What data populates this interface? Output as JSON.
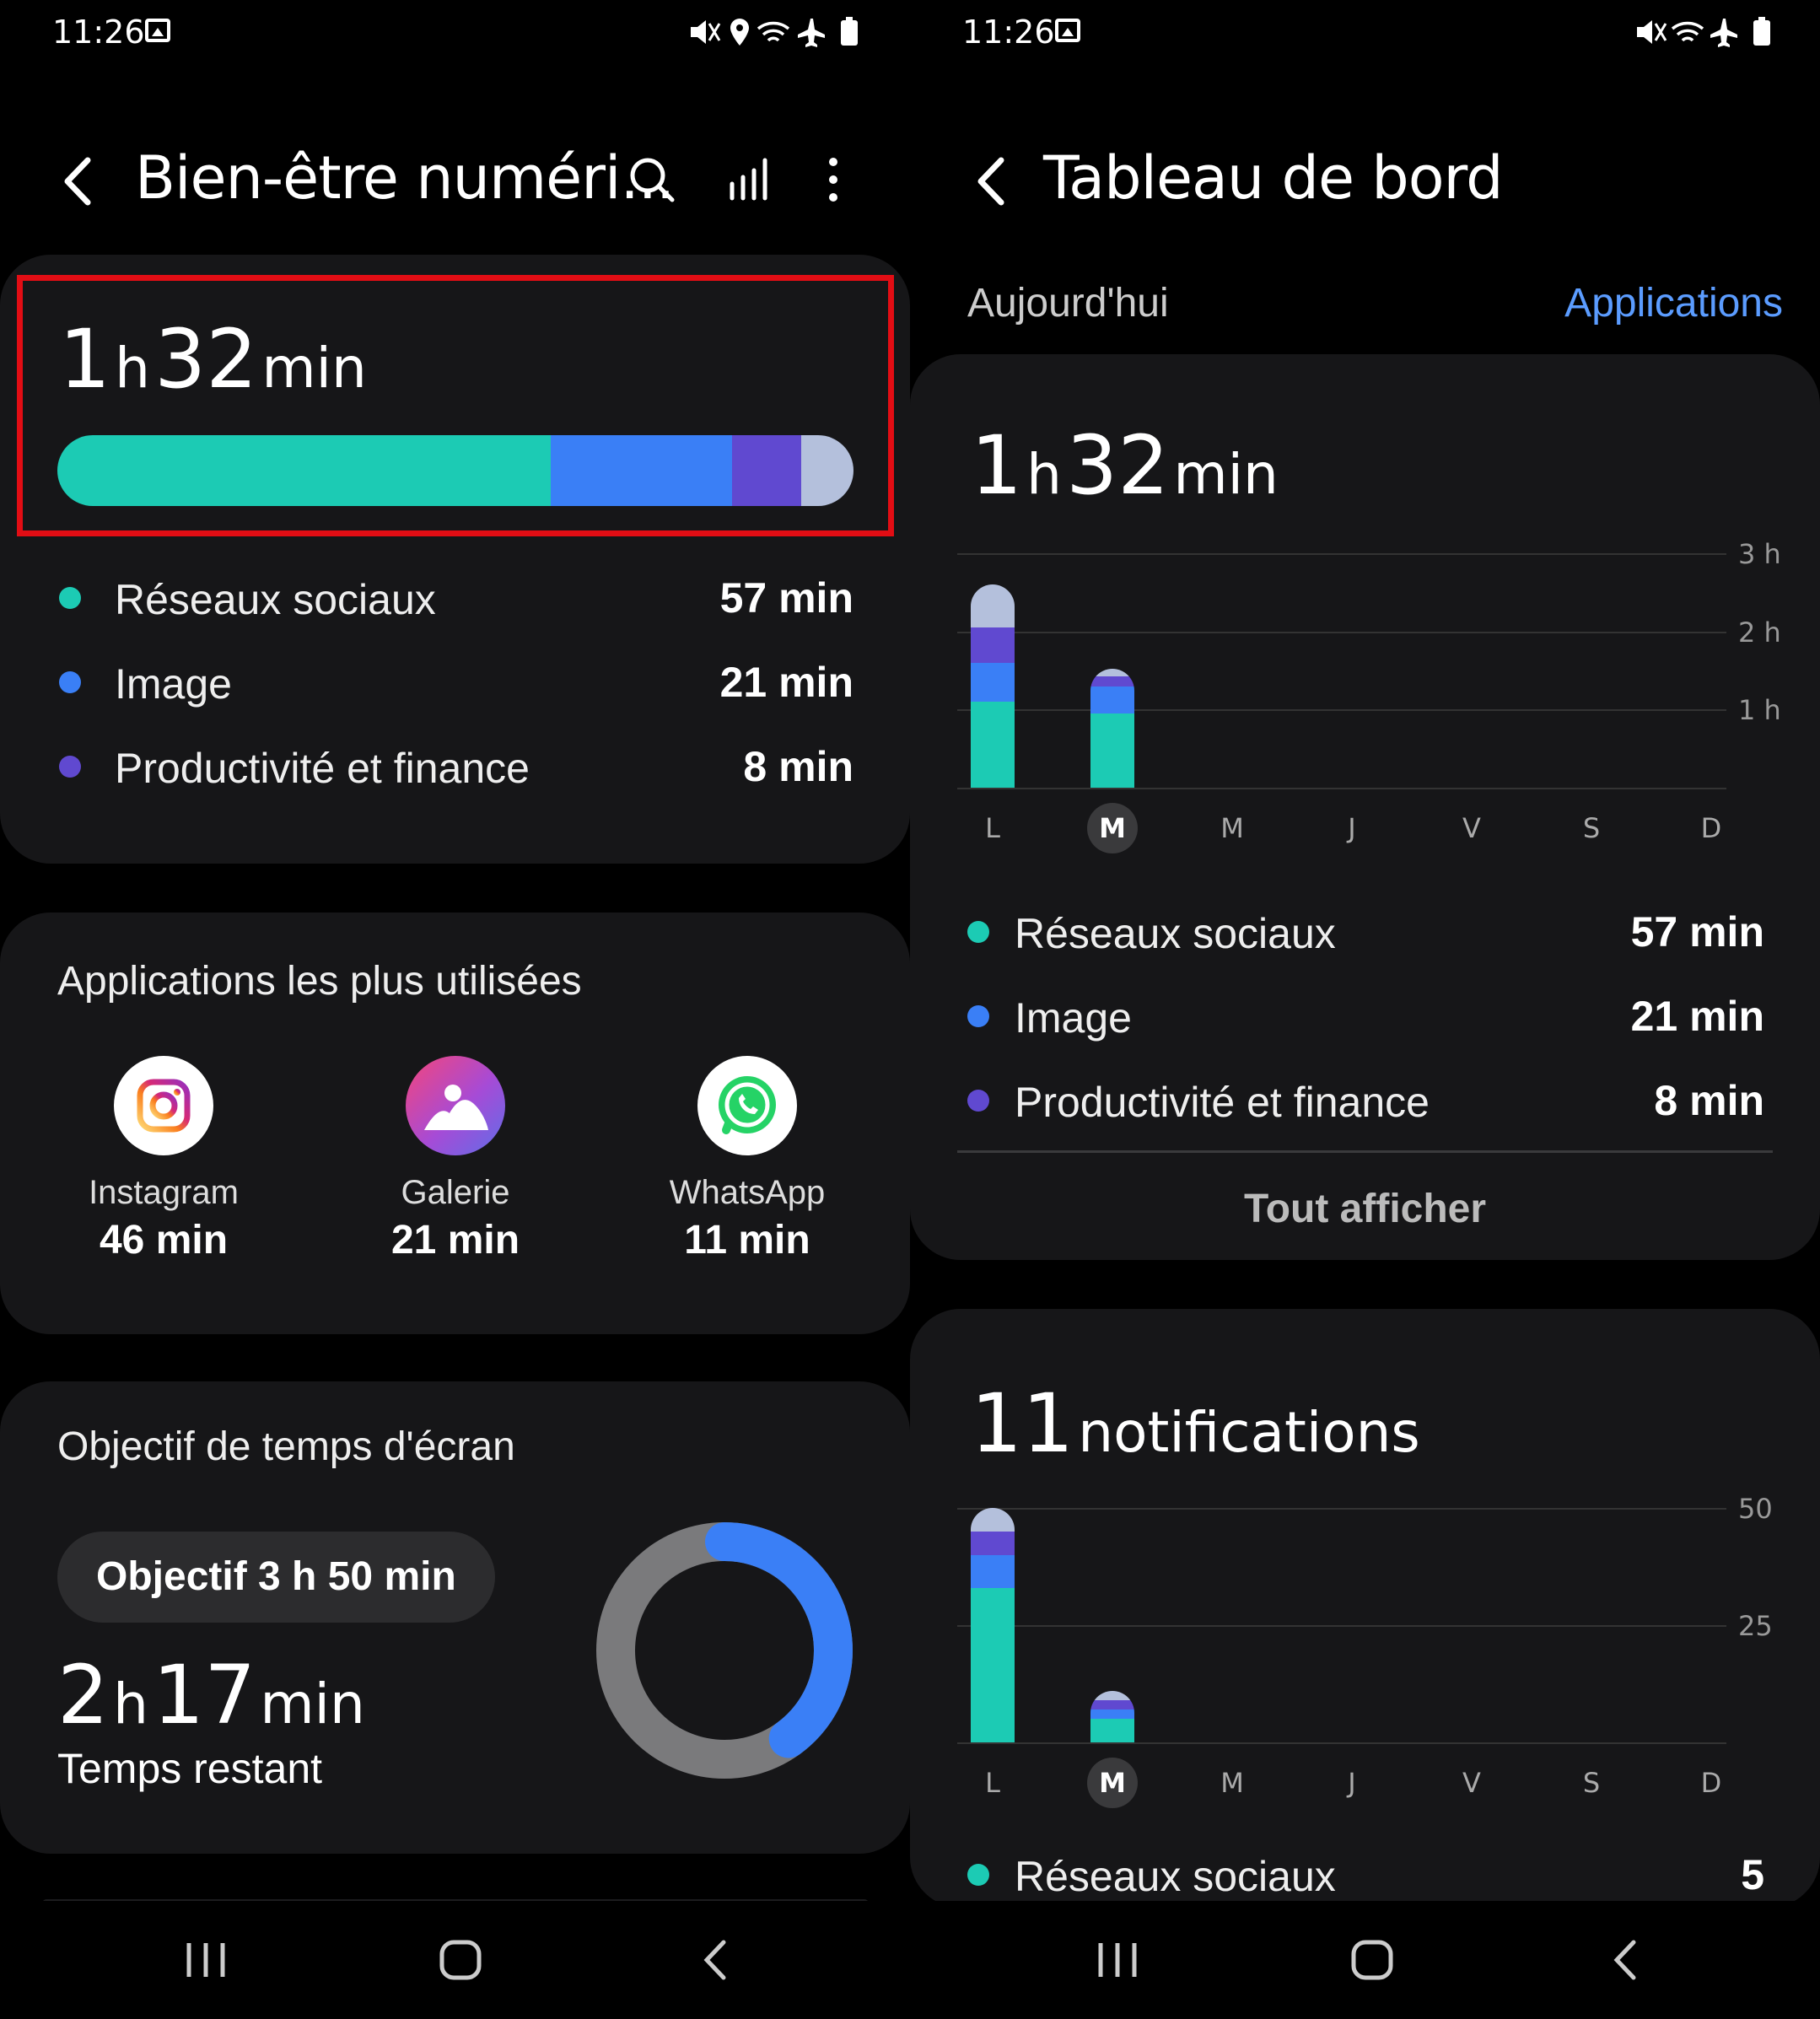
{
  "colors": {
    "social": "#1ccbb4",
    "image": "#3a7ff6",
    "productivity": "#6049d0",
    "other": "#b4c0dc",
    "accent_blue": "#5b9cff",
    "highlight_red": "#e20d14",
    "ring_gray": "#7a7a7c"
  },
  "status": {
    "time": "11:26",
    "icons_left": "ðŸ”‡ðŸ“ðŸ“¶âœˆðŸ”‹",
    "icons_right": "ðŸ”‡ðŸ“¶âœˆðŸ”‹"
  },
  "left": {
    "title": "Bien-être numéri...",
    "total": {
      "h": "1",
      "h_unit": "h",
      "m": "32",
      "m_unit": "min"
    },
    "usage_split": {
      "social": 57,
      "image": 21,
      "productivity": 8,
      "other": 6
    },
    "categories": [
      {
        "label": "Réseaux sociaux",
        "value": "57 min",
        "color": "#1ccbb4"
      },
      {
        "label": "Image",
        "value": "21 min",
        "color": "#3a7ff6"
      },
      {
        "label": "Productivité et finance",
        "value": "8 min",
        "color": "#6049d0"
      }
    ],
    "apps_title": "Applications les plus utilisées",
    "apps": [
      {
        "name": "Instagram",
        "time": "46 min",
        "icon": "instagram-icon"
      },
      {
        "name": "Galerie",
        "time": "21 min",
        "icon": "gallery-icon"
      },
      {
        "name": "WhatsApp",
        "time": "11 min",
        "icon": "whatsapp-icon"
      }
    ],
    "goal": {
      "title": "Objectif de temps d'écran",
      "pill": "Objectif 3 h 50 min",
      "remaining": {
        "h": "2",
        "h_unit": "h",
        "m": "17",
        "m_unit": "min"
      },
      "remaining_label": "Temps restant",
      "used_fraction": 0.4
    }
  },
  "right": {
    "title": "Tableau de bord",
    "period": "Aujourd'hui",
    "link": "Applications",
    "screen_time": {
      "total": {
        "h": "1",
        "h_unit": "h",
        "m": "32",
        "m_unit": "min"
      },
      "axis": [
        "3 h",
        "2 h",
        "1 h"
      ],
      "days": [
        "L",
        "M",
        "M",
        "J",
        "V",
        "S",
        "D"
      ],
      "selected_day": 1,
      "categories": [
        {
          "label": "Réseaux sociaux",
          "value": "57 min",
          "color": "#1ccbb4"
        },
        {
          "label": "Image",
          "value": "21 min",
          "color": "#3a7ff6"
        },
        {
          "label": "Productivité et finance",
          "value": "8 min",
          "color": "#6049d0"
        }
      ],
      "show_all": "Tout afficher"
    },
    "notifications": {
      "count": "11",
      "label": "notifications",
      "axis": [
        "50",
        "25"
      ],
      "days": [
        "L",
        "M",
        "M",
        "J",
        "V",
        "S",
        "D"
      ],
      "selected_day": 1,
      "first_row": {
        "label": "Réseaux sociaux",
        "value": "5",
        "color": "#1ccbb4"
      }
    }
  },
  "chart_data": [
    {
      "type": "bar",
      "title": "1 h 32 min",
      "categories": [
        "L",
        "M",
        "M",
        "J",
        "V",
        "S",
        "D"
      ],
      "ylim": [
        0,
        3
      ],
      "series": [
        {
          "name": "Réseaux sociaux",
          "values": [
            1.1,
            0.95,
            0,
            0,
            0,
            0,
            0
          ]
        },
        {
          "name": "Image",
          "values": [
            0.5,
            0.35,
            0,
            0,
            0,
            0,
            0
          ]
        },
        {
          "name": "Productivité et finance",
          "values": [
            0.45,
            0.13,
            0,
            0,
            0,
            0,
            0
          ]
        },
        {
          "values": [
            0.55,
            0.09,
            0,
            0,
            0,
            0,
            0
          ]
        }
      ]
    },
    {
      "type": "bar",
      "title": "11 notifications",
      "categories": [
        "L",
        "M",
        "M",
        "J",
        "V",
        "S",
        "D"
      ],
      "ylim": [
        0,
        50
      ],
      "series": [
        {
          "name": "Réseaux sociaux",
          "values": [
            33,
            5,
            0,
            0,
            0,
            0,
            0
          ]
        },
        {
          "name": "Image",
          "values": [
            7,
            2,
            0,
            0,
            0,
            0,
            0
          ]
        },
        {
          "name": "Productivité et finance",
          "values": [
            5,
            2,
            0,
            0,
            0,
            0,
            0
          ]
        },
        {
          "values": [
            5,
            2,
            0,
            0,
            0,
            0,
            0
          ]
        }
      ]
    }
  ]
}
